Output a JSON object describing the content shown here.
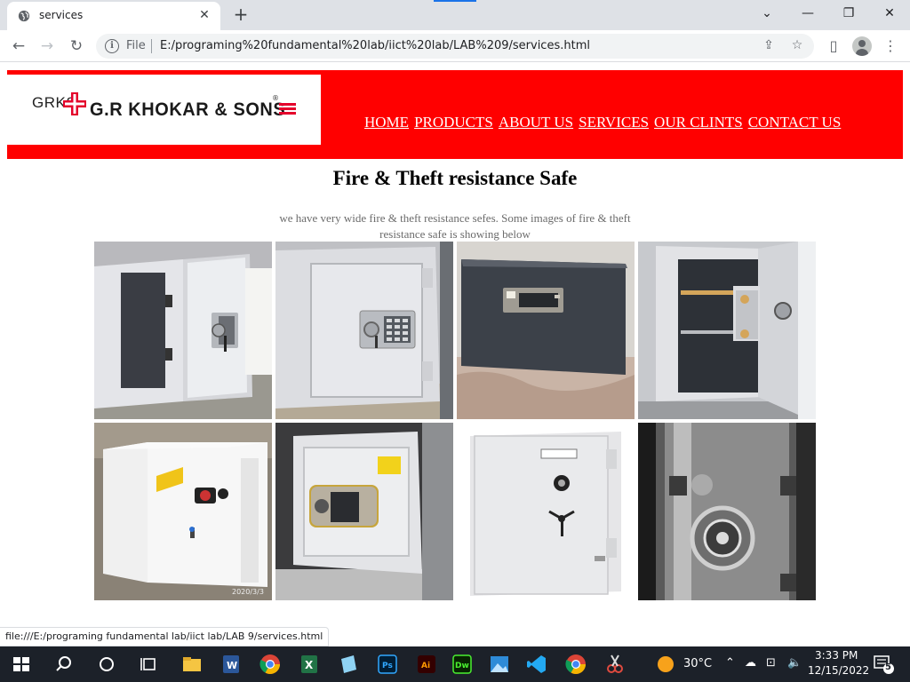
{
  "browser": {
    "tab_title": "services",
    "url_scheme": "File",
    "url": "E:/programing%20fundamental%20lab/iict%20lab/LAB%209/services.html",
    "status_url": "file:///E:/programing fundamental lab/iict lab/LAB 9/services.html"
  },
  "site": {
    "logo_prefix": "GRKS",
    "logo_name": "G.R KHOKAR & SONS",
    "nav": [
      {
        "label": "HOME"
      },
      {
        "label": "PRODUCTS"
      },
      {
        "label": "ABOUT US"
      },
      {
        "label": "SERVICES"
      },
      {
        "label": "OUR CLINTS"
      },
      {
        "label": "CONTACT US"
      }
    ],
    "heading": "Fire & Theft resistance Safe",
    "intro": "we have very wide fire & theft resistance sefes. Some images of fire & theft resistance safe is showing below",
    "photo_captions": [
      "2020/3/3"
    ]
  },
  "taskbar": {
    "weather": "30°C",
    "time": "3:33 PM",
    "date": "12/15/2022",
    "notifications": "5"
  },
  "colors": {
    "header_red": "#ff0000",
    "taskbar": "#1c2129"
  }
}
